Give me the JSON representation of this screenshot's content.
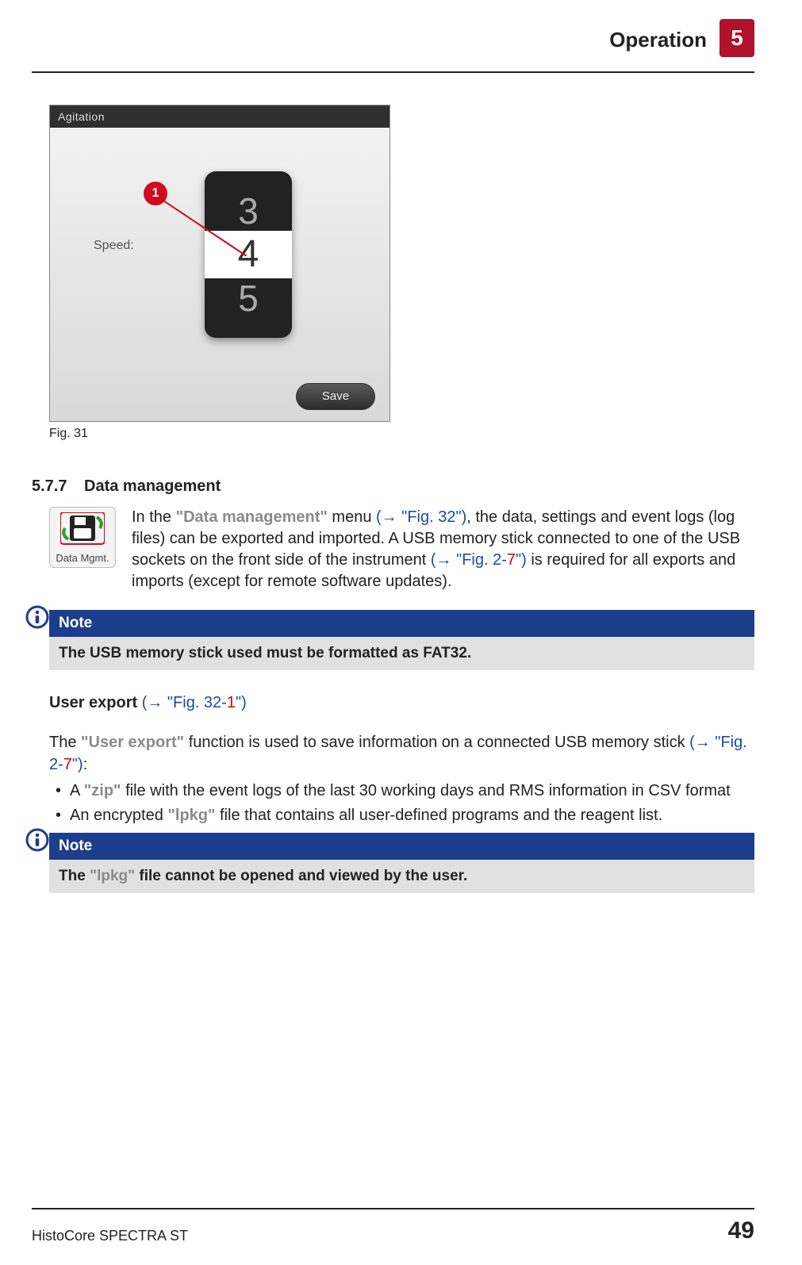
{
  "header": {
    "title": "Operation",
    "chapter": "5"
  },
  "figure": {
    "panelTitle": "Agitation",
    "speedLabel": "Speed:",
    "dialPrev": "3",
    "dialSel": "4",
    "dialNext": "5",
    "saveLabel": "Save",
    "callout": "1",
    "caption": "Fig. 31"
  },
  "section": {
    "num": "5.7.7",
    "title": "Data management"
  },
  "icon": {
    "label": "Data Mgmt."
  },
  "intro": {
    "t1": "In the ",
    "dm": "\"Data management\"",
    "t2": " menu ",
    "ref1a": "(→ \"Fig. 32\")",
    "t3": ", the data, settings and event logs (log files) can be exported and imported. A USB memory stick connected to one of the USB sockets on the front side of the instrument ",
    "ref2_open": "(→ \"Fig. 2-",
    "ref2_num": "7",
    "ref2_close": "\")",
    "t4": " is required for all exports and imports (except for remote software updates)."
  },
  "note1": {
    "header": "Note",
    "body": "The USB memory stick used must be formatted as FAT32."
  },
  "userExport": {
    "heading": "User export",
    "refOpen": " (→ \"Fig. 32-",
    "refNum": "1",
    "refClose": "\")"
  },
  "para2": {
    "t1": "The ",
    "ue": "\"User export\"",
    "t2": " function is used to save information on a connected USB memory stick ",
    "refOpen": "(→ \"Fig. 2-",
    "refNum": "7",
    "refClose": "\")",
    "tEnd": ":"
  },
  "bullets": {
    "b1a": "A ",
    "b1zip": "\"zip\"",
    "b1b": " file with the event logs of the last 30 working days and RMS information in CSV format",
    "b2a": "An encrypted ",
    "b2lpkg": "\"lpkg\"",
    "b2b": " file that contains all user-defined programs and the reagent list."
  },
  "note2": {
    "header": "Note",
    "t1": "The ",
    "lpkg": "\"lpkg\"",
    "t2": " file cannot be opened and viewed by the user."
  },
  "footer": {
    "product": "HistoCore SPECTRA ST",
    "page": "49"
  }
}
